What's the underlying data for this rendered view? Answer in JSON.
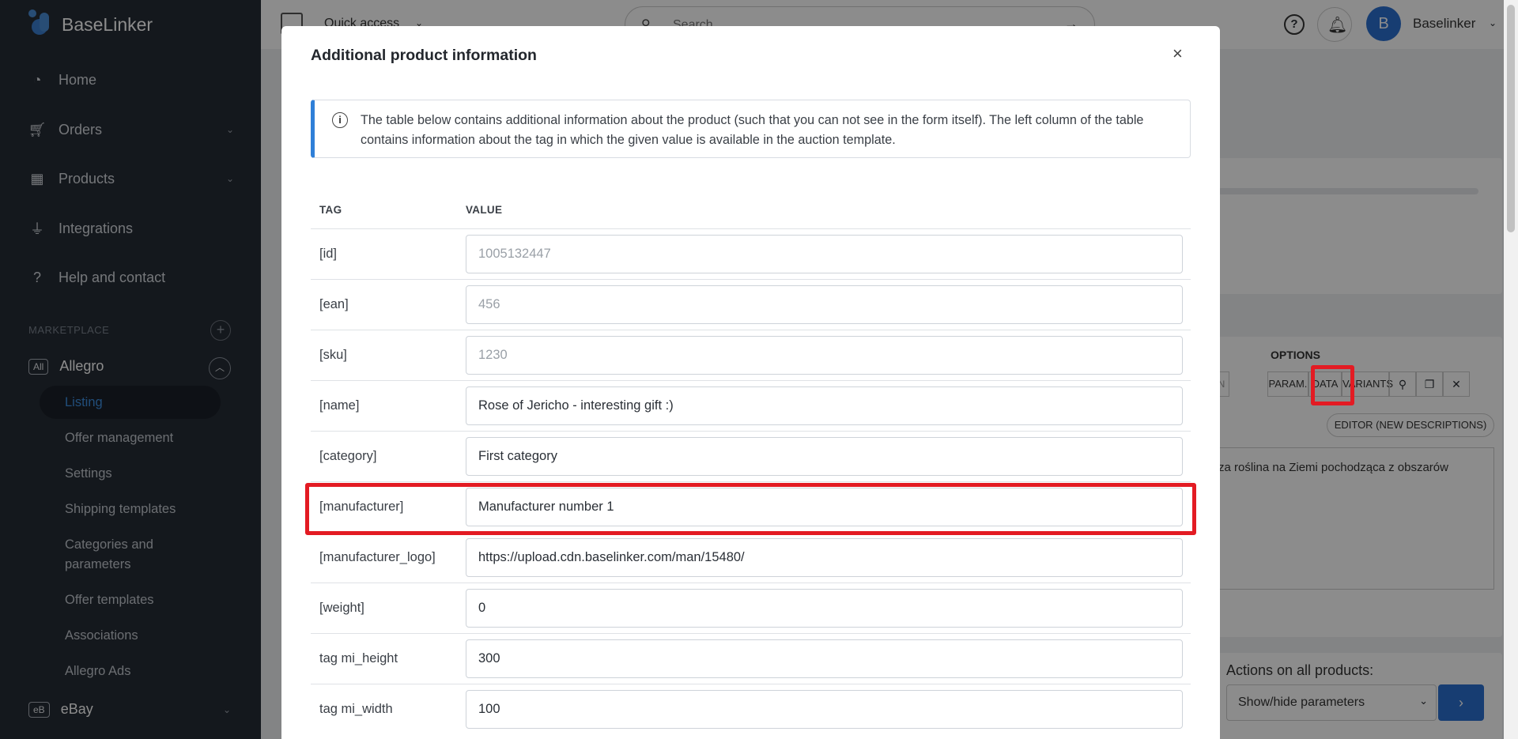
{
  "sidebar": {
    "brand": "BaseLinker",
    "items": [
      {
        "label": "Home"
      },
      {
        "label": "Orders"
      },
      {
        "label": "Products"
      },
      {
        "label": "Integrations"
      },
      {
        "label": "Help and contact"
      }
    ],
    "section_label": "MARKETPLACE",
    "allegro": {
      "badge": "All",
      "label": "Allegro"
    },
    "subitems": [
      {
        "label": "Listing"
      },
      {
        "label": "Offer management"
      },
      {
        "label": "Settings"
      },
      {
        "label": "Shipping templates"
      },
      {
        "label": "Categories and"
      },
      {
        "label": "parameters"
      },
      {
        "label": "Offer templates"
      },
      {
        "label": "Associations"
      },
      {
        "label": "Allegro Ads"
      }
    ],
    "ebay": {
      "badge": "eB",
      "label": "eBay"
    }
  },
  "topbar": {
    "quick_access": "Quick access",
    "search_placeholder": "Search",
    "avatar_letter": "B",
    "user_name": "Baselinker"
  },
  "background": {
    "options_label": "OPTIONS",
    "cut_button": "N",
    "param_button": "PARAM.",
    "data_button": "DATA",
    "variants_button": "VARIANTS",
    "editor_button": "EDITOR (NEW DESCRIPTIONS)",
    "description_snippet": "za roślina na Ziemi pochodząca z obszarów",
    "actions_label": "Actions on all products:",
    "actions_select": "Show/hide parameters"
  },
  "modal": {
    "title": "Additional product information",
    "close": "×",
    "info": "The table below contains additional information about the product (such that you can not see in the form itself). The left column of the table contains information about the tag in which the given value is available in the auction template.",
    "col_tag": "TAG",
    "col_value": "VALUE",
    "rows": [
      {
        "tag": "[id]",
        "value": "1005132447"
      },
      {
        "tag": "[ean]",
        "value": "456"
      },
      {
        "tag": "[sku]",
        "value": "1230"
      },
      {
        "tag": "[name]",
        "value": "Rose of Jericho - interesting gift :)"
      },
      {
        "tag": "[category]",
        "value": "First category"
      },
      {
        "tag": "[manufacturer]",
        "value": "Manufacturer number 1"
      },
      {
        "tag": "[manufacturer_logo]",
        "value": "https://upload.cdn.baselinker.com/man/15480/"
      },
      {
        "tag": "[weight]",
        "value": "0"
      },
      {
        "tag": "tag mi_height",
        "value": "300"
      },
      {
        "tag": "tag mi_width",
        "value": "100"
      }
    ]
  }
}
